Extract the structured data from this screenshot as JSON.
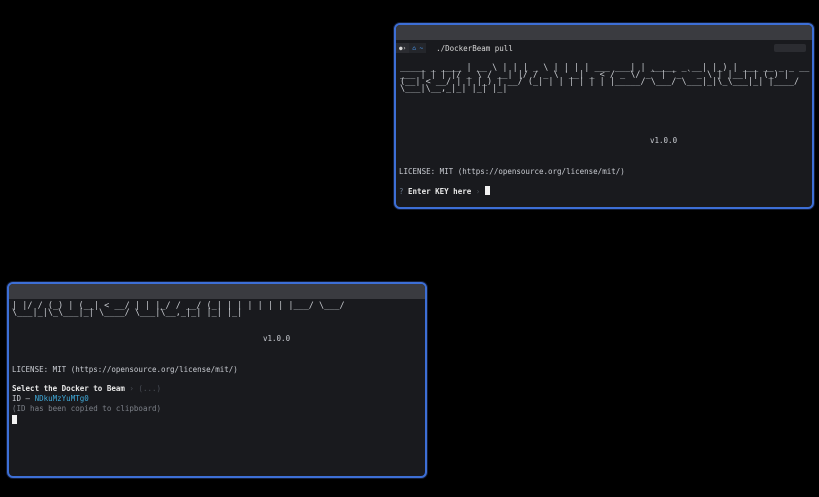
{
  "colors": {
    "background": "#000000",
    "terminal_bg": "#191a1e",
    "border_accent": "#3d6fd6",
    "cyan_id": "#3fa9d8"
  },
  "top_terminal": {
    "prompt_dir_icon": "home-icon",
    "command": "./DockerBeam pull",
    "ascii_logo": " _____             _             ____                         \n|  __ \\           | |           |  _ \\                        \n| |  | | ___   ___| | _____ _ __| |_) | ___  __ _ _ __ ___    \n| |  | |/ _ \\ / __| |/ / _ \\ '__|  _ < / _ \\/ _` | '_ ` _ \\   \n| |__| | (_) | (__|   <  __/ |  | |_) |  __/ (_| | | | | | |  \n|_____/ \\___/ \\___|_|\\_\\___|_|  |____/ \\___|\\__,_|_| |_| |_|  ",
    "version": "v1.0.0",
    "license": "LICENSE: MIT (https://opensource.org/license/mit/)",
    "prompt_symbol": "?",
    "prompt_label": "Enter KEY here",
    "prompt_chevron": "›"
  },
  "bottom_terminal": {
    "ascii_logo": "| |/ / (_) | (__|   <  __/ |  | |_/ / __/ (_| | | | | | |\n|___/ \\___/ \\___|_|\\_\\___|_|  \\____/ \\___|\\__,_|_| |_| |_|",
    "version": "v1.0.0",
    "license": "LICENSE: MIT (https://opensource.org/license/mit/)",
    "select_label": "Select the Docker to Beam",
    "select_hint": "› (...)",
    "id_prefix": "ID – ",
    "id_value": "NDkuMzYuMTg0",
    "clipboard_note": "(ID has been copied to clipboard)"
  }
}
